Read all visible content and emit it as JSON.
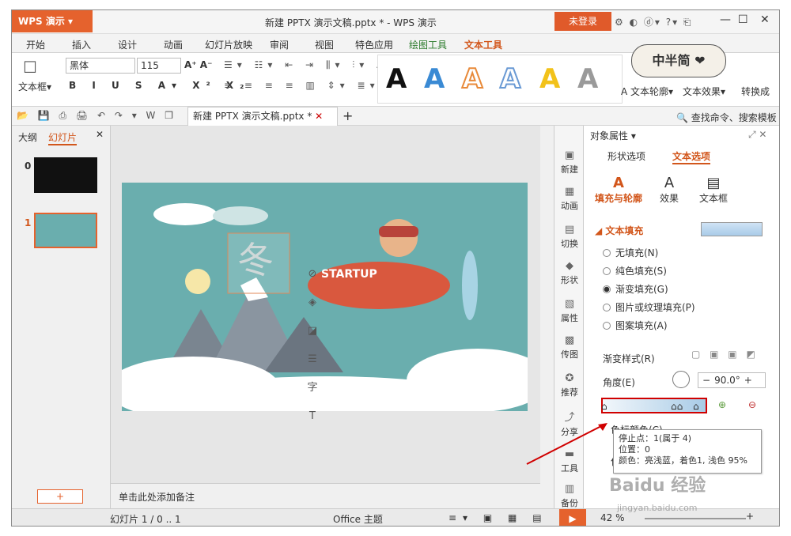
{
  "app": {
    "menu_button": "WPS 演示",
    "title": "新建 PPTX 演示文稿.pptx * - WPS 演示",
    "login": "未登录"
  },
  "menus": [
    "开始",
    "插入",
    "设计",
    "动画",
    "幻灯片放映",
    "审阅",
    "视图",
    "特色应用",
    "绘图工具",
    "文本工具"
  ],
  "ribbon": {
    "textbox": "文本框",
    "font": "黑体",
    "size": "115",
    "outline": "文本轮廓",
    "effect": "文本效果",
    "convert": "转换成",
    "styles_label": "A"
  },
  "qa": {
    "doc_tab": "新建 PPTX 演示文稿.pptx",
    "search": "查找命令、搜索模板"
  },
  "left": {
    "tab_outline": "大纲",
    "tab_slides": "幻灯片",
    "slide_nums": [
      "0",
      "1"
    ]
  },
  "vt": [
    "新建",
    "动画",
    "切换",
    "形状",
    "属性",
    "传图",
    "推荐",
    "分享",
    "工具",
    "备份"
  ],
  "panel": {
    "title": "对象属性",
    "tab_shape": "形状选项",
    "tab_text": "文本选项",
    "sub_fill": "填充与轮廓",
    "sub_effect": "效果",
    "sub_box": "文本框",
    "section": "文本填充",
    "radios": [
      "无填充(N)",
      "纯色填充(S)",
      "渐变填充(G)",
      "图片或纹理填充(P)",
      "图案填充(A)"
    ],
    "grad_style": "渐变样式(R)",
    "angle_label": "角度(E)",
    "angle_value": "90.0°",
    "stop_color": "色标颜色(C)",
    "pos": "位"
  },
  "tooltip": {
    "line1": "停止点：1(属于 4)",
    "line2": "位置：0",
    "line3": "颜色：亮浅蓝，着色1, 浅色 95%"
  },
  "slide": {
    "char": "冬",
    "startup": "STARTUP"
  },
  "notes": "单击此处添加备注",
  "status": {
    "slide": "幻灯片 1 / 0 .. 1",
    "theme": "Office 主题",
    "zoom": "42 %"
  },
  "stamp": "中半简 ❤",
  "watermark": {
    "line1": "Baidu 经验",
    "line2": "jingyan.baidu.com"
  }
}
